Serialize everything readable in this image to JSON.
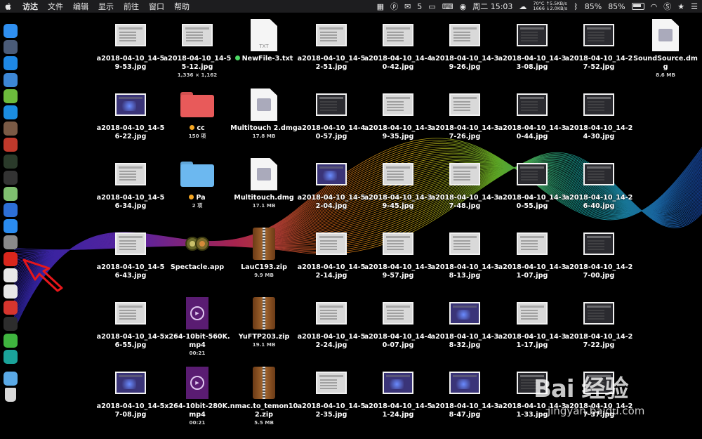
{
  "menubar": {
    "app_name": "访达",
    "menus": [
      "文件",
      "编辑",
      "显示",
      "前往",
      "窗口",
      "帮助"
    ],
    "wechat_count": "5",
    "clock": "周二 15:03",
    "cpu_temp": "70°C",
    "fan_rpm": "1666",
    "upload_speed": "↑5.5KB/s",
    "download_speed": "↓2.0KB/s",
    "battery_1": "85%",
    "battery_2": "85%"
  },
  "dock": {
    "icons": [
      {
        "name": "finder-icon",
        "color": "#2f8ff0"
      },
      {
        "name": "launchpad-icon",
        "color": "#4a5b78"
      },
      {
        "name": "safari-icon",
        "color": "#1e88e5"
      },
      {
        "name": "preview-icon",
        "color": "#3d87d6"
      },
      {
        "name": "android-icon",
        "color": "#6cbb3c"
      },
      {
        "name": "teamviewer-icon",
        "color": "#1b8de0"
      },
      {
        "name": "gear-app-icon",
        "color": "#7a5a45"
      },
      {
        "name": "audio-app-icon",
        "color": "#c0392b"
      },
      {
        "name": "activity-monitor-icon",
        "color": "#2a3a2a"
      },
      {
        "name": "terminal-icon",
        "color": "#333333"
      },
      {
        "name": "maps-icon",
        "color": "#7fbf6f"
      },
      {
        "name": "siri-icon",
        "color": "#2d6fd6"
      },
      {
        "name": "app-store-icon",
        "color": "#2a8cf0"
      },
      {
        "name": "system-preferences-icon",
        "color": "#8a8a8a"
      },
      {
        "name": "netease-music-icon",
        "color": "#d9261c"
      },
      {
        "name": "yandex-icon",
        "color": "#e8e8e8"
      },
      {
        "name": "chrome-icon",
        "color": "#e8e8e8"
      },
      {
        "name": "vivaldi-icon",
        "color": "#d6352e"
      },
      {
        "name": "iterm-icon",
        "color": "#2d2d2d"
      },
      {
        "name": "wechat-icon",
        "color": "#3fb53f"
      },
      {
        "name": "sync-app-icon",
        "color": "#1aa39a"
      },
      {
        "name": "downloads-folder-icon",
        "color": "#5aa9e6"
      },
      {
        "name": "trash-icon",
        "color": "#d8d8d8"
      }
    ]
  },
  "desktop": {
    "rows": [
      [
        {
          "name": "a2018-04-10_14-59-53.jpg",
          "kind": "thumb",
          "style": "light"
        },
        {
          "name": "a2018-04-10_14-55-12.jpg",
          "sub": "1,336 × 1,162",
          "kind": "thumb",
          "style": "light"
        },
        {
          "name": "NewFile-3.txt",
          "kind": "txt",
          "tag": "#4cd964",
          "doc_label": "TXT"
        },
        {
          "name": "a2018-04-10_14-52-51.jpg",
          "kind": "thumb",
          "style": "light"
        },
        {
          "name": "a2018-04-10_14-40-42.jpg",
          "kind": "thumb",
          "style": "light"
        },
        {
          "name": "a2018-04-10_14-39-26.jpg",
          "kind": "thumb",
          "style": "light"
        },
        {
          "name": "a2018-04-10_14-33-08.jpg",
          "kind": "thumb",
          "style": "dark"
        },
        {
          "name": "a2018-04-10_14-27-52.jpg",
          "kind": "thumb",
          "style": "dark"
        },
        {
          "name": "SoundSource.dmg",
          "sub": "8.6 MB",
          "kind": "dmg"
        }
      ],
      [
        {
          "name": "a2018-04-10_14-56-22.jpg",
          "kind": "thumb",
          "style": "purple"
        },
        {
          "name": "cc",
          "sub": "150 项",
          "kind": "folder",
          "color": "#e85a5a",
          "tag": "#f5a623"
        },
        {
          "name": "Multitouch 2.dmg",
          "sub": "17.8 MB",
          "kind": "dmg"
        },
        {
          "name": "a2018-04-10_14-40-57.jpg",
          "kind": "thumb",
          "style": "dark"
        },
        {
          "name": "a2018-04-10_14-39-35.jpg",
          "kind": "thumb",
          "style": "light"
        },
        {
          "name": "a2018-04-10_14-37-26.jpg",
          "kind": "thumb",
          "style": "light"
        },
        {
          "name": "a2018-04-10_14-30-44.jpg",
          "kind": "thumb",
          "style": "dark"
        },
        {
          "name": "a2018-04-10_14-24-30.jpg",
          "kind": "thumb",
          "style": "dark"
        }
      ],
      [
        {
          "name": "a2018-04-10_14-56-34.jpg",
          "kind": "thumb",
          "style": "light"
        },
        {
          "name": "Pa",
          "sub": "2 项",
          "kind": "folder",
          "color": "#6cb8f0",
          "tag": "#f5a623"
        },
        {
          "name": "Multitouch.dmg",
          "sub": "17.1 MB",
          "kind": "dmg"
        },
        {
          "name": "a2018-04-10_14-52-04.jpg",
          "kind": "thumb",
          "style": "purple"
        },
        {
          "name": "a2018-04-10_14-39-45.jpg",
          "kind": "thumb",
          "style": "light"
        },
        {
          "name": "a2018-04-10_14-37-48.jpg",
          "kind": "thumb",
          "style": "light"
        },
        {
          "name": "a2018-04-10_14-30-55.jpg",
          "kind": "thumb",
          "style": "dark"
        },
        {
          "name": "a2018-04-10_14-26-40.jpg",
          "kind": "thumb",
          "style": "dark"
        }
      ],
      [
        {
          "name": "a2018-04-10_14-56-43.jpg",
          "kind": "thumb",
          "style": "light"
        },
        {
          "name": "Spectacle.app",
          "kind": "app"
        },
        {
          "name": "LauC193.zip",
          "sub": "9.9 MB",
          "kind": "zip"
        },
        {
          "name": "a2018-04-10_14-52-14.jpg",
          "kind": "thumb",
          "style": "light"
        },
        {
          "name": "a2018-04-10_14-39-57.jpg",
          "kind": "thumb",
          "style": "light"
        },
        {
          "name": "a2018-04-10_14-38-13.jpg",
          "kind": "thumb",
          "style": "light"
        },
        {
          "name": "a2018-04-10_14-31-07.jpg",
          "kind": "thumb",
          "style": "light"
        },
        {
          "name": "a2018-04-10_14-27-00.jpg",
          "kind": "thumb",
          "style": "dark"
        }
      ],
      [
        {
          "name": "a2018-04-10_14-56-55.jpg",
          "kind": "thumb",
          "style": "light"
        },
        {
          "name": "x264-10bit-560K.mp4",
          "sub": "00:21",
          "kind": "video"
        },
        {
          "name": "YuFTP203.zip",
          "sub": "19.1 MB",
          "kind": "zip"
        },
        {
          "name": "a2018-04-10_14-52-24.jpg",
          "kind": "thumb",
          "style": "light"
        },
        {
          "name": "a2018-04-10_14-40-07.jpg",
          "kind": "thumb",
          "style": "light"
        },
        {
          "name": "a2018-04-10_14-38-32.jpg",
          "kind": "thumb",
          "style": "purple"
        },
        {
          "name": "a2018-04-10_14-31-17.jpg",
          "kind": "thumb",
          "style": "light"
        },
        {
          "name": "a2018-04-10_14-27-22.jpg",
          "kind": "thumb",
          "style": "dark"
        }
      ],
      [
        {
          "name": "a2018-04-10_14-57-08.jpg",
          "kind": "thumb",
          "style": "purple"
        },
        {
          "name": "x264-10bit-280K.mp4",
          "sub": "00:21",
          "kind": "video"
        },
        {
          "name": "nmac.to_temon102.zip",
          "sub": "5.5 MB",
          "kind": "zip"
        },
        {
          "name": "a2018-04-10_14-52-35.jpg",
          "kind": "thumb",
          "style": "light"
        },
        {
          "name": "a2018-04-10_14-51-24.jpg",
          "kind": "thumb",
          "style": "purple"
        },
        {
          "name": "a2018-04-10_14-38-47.jpg",
          "kind": "thumb",
          "style": "purple"
        },
        {
          "name": "a2018-04-10_14-31-33.jpg",
          "kind": "thumb",
          "style": "dark"
        },
        {
          "name": "a2018-04-10_14-27-37.jpg",
          "kind": "thumb",
          "style": "dark"
        }
      ]
    ]
  },
  "watermark": {
    "brand": "Bai 经验",
    "url": "jingyan.baidu.com"
  }
}
